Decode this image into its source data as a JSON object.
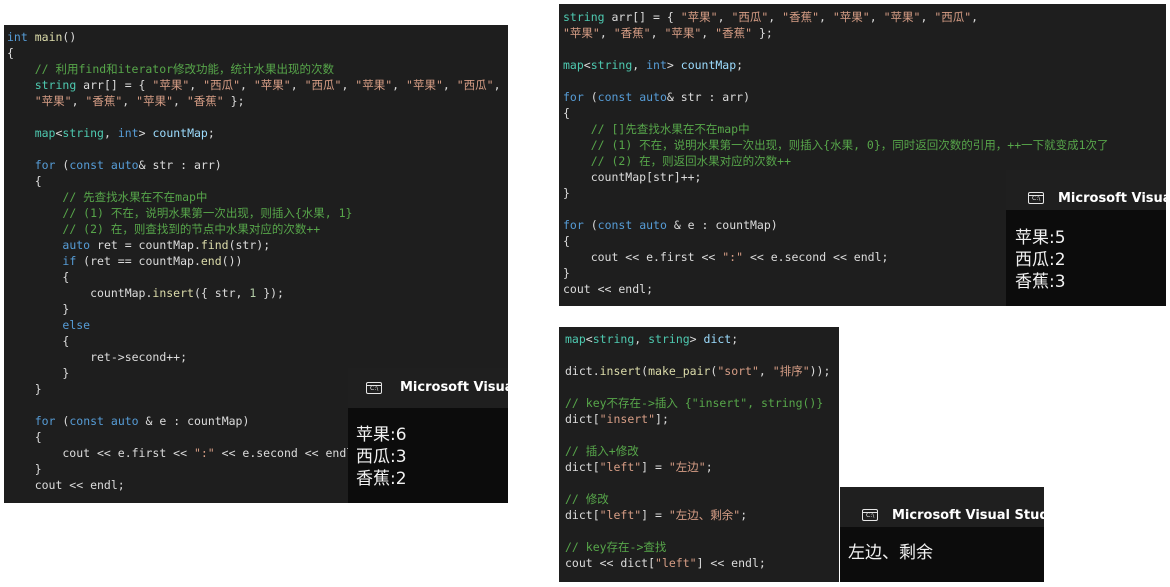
{
  "panel_left": {
    "lines": [
      [
        {
          "t": "int",
          "c": "kw"
        },
        {
          "t": " "
        },
        {
          "t": "main",
          "c": "fn"
        },
        {
          "t": "()"
        }
      ],
      [
        {
          "t": "{"
        }
      ],
      [
        {
          "t": "    "
        },
        {
          "t": "// 利用find和iterator修改功能，统计水果出现的次数",
          "c": "cm"
        }
      ],
      [
        {
          "t": "    "
        },
        {
          "t": "string",
          "c": "ty"
        },
        {
          "t": " arr[] = { "
        },
        {
          "t": "\"苹果\"",
          "c": "str"
        },
        {
          "t": ", "
        },
        {
          "t": "\"西瓜\"",
          "c": "str"
        },
        {
          "t": ", "
        },
        {
          "t": "\"苹果\"",
          "c": "str"
        },
        {
          "t": ", "
        },
        {
          "t": "\"西瓜\"",
          "c": "str"
        },
        {
          "t": ", "
        },
        {
          "t": "\"苹果\"",
          "c": "str"
        },
        {
          "t": ", "
        },
        {
          "t": "\"苹果\"",
          "c": "str"
        },
        {
          "t": ", "
        },
        {
          "t": "\"西瓜\"",
          "c": "str"
        },
        {
          "t": ","
        }
      ],
      [
        {
          "t": "    "
        },
        {
          "t": "\"苹果\"",
          "c": "str"
        },
        {
          "t": ", "
        },
        {
          "t": "\"香蕉\"",
          "c": "str"
        },
        {
          "t": ", "
        },
        {
          "t": "\"苹果\"",
          "c": "str"
        },
        {
          "t": ", "
        },
        {
          "t": "\"香蕉\"",
          "c": "str"
        },
        {
          "t": " };"
        }
      ],
      [],
      [
        {
          "t": "    "
        },
        {
          "t": "map",
          "c": "ty"
        },
        {
          "t": "<"
        },
        {
          "t": "string",
          "c": "ty"
        },
        {
          "t": ", "
        },
        {
          "t": "int",
          "c": "kw"
        },
        {
          "t": "> "
        },
        {
          "t": "countMap",
          "c": "var"
        },
        {
          "t": ";"
        }
      ],
      [],
      [
        {
          "t": "    "
        },
        {
          "t": "for",
          "c": "kw"
        },
        {
          "t": " ("
        },
        {
          "t": "const",
          "c": "kw"
        },
        {
          "t": " "
        },
        {
          "t": "auto",
          "c": "kw"
        },
        {
          "t": "& str : arr)"
        }
      ],
      [
        {
          "t": "    {"
        }
      ],
      [
        {
          "t": "        "
        },
        {
          "t": "// 先查找水果在不在map中",
          "c": "cm"
        }
      ],
      [
        {
          "t": "        "
        },
        {
          "t": "// (1) 不在，说明水果第一次出现，则插入{水果, 1}",
          "c": "cm"
        }
      ],
      [
        {
          "t": "        "
        },
        {
          "t": "// (2) 在，则查找到的节点中水果对应的次数++",
          "c": "cm"
        }
      ],
      [
        {
          "t": "        "
        },
        {
          "t": "auto",
          "c": "kw"
        },
        {
          "t": " ret = countMap."
        },
        {
          "t": "find",
          "c": "fn"
        },
        {
          "t": "(str);"
        }
      ],
      [
        {
          "t": "        "
        },
        {
          "t": "if",
          "c": "kw"
        },
        {
          "t": " (ret == countMap."
        },
        {
          "t": "end",
          "c": "fn"
        },
        {
          "t": "())"
        }
      ],
      [
        {
          "t": "        {"
        }
      ],
      [
        {
          "t": "            countMap."
        },
        {
          "t": "insert",
          "c": "fn"
        },
        {
          "t": "({ str, "
        },
        {
          "t": "1",
          "c": "num"
        },
        {
          "t": " });"
        }
      ],
      [
        {
          "t": "        }"
        }
      ],
      [
        {
          "t": "        "
        },
        {
          "t": "else",
          "c": "kw"
        }
      ],
      [
        {
          "t": "        {"
        }
      ],
      [
        {
          "t": "            ret->second++;"
        }
      ],
      [
        {
          "t": "        }"
        }
      ],
      [
        {
          "t": "    }"
        }
      ],
      [],
      [
        {
          "t": "    "
        },
        {
          "t": "for",
          "c": "kw"
        },
        {
          "t": " ("
        },
        {
          "t": "const",
          "c": "kw"
        },
        {
          "t": " "
        },
        {
          "t": "auto",
          "c": "kw"
        },
        {
          "t": " & e : countMap)"
        }
      ],
      [
        {
          "t": "    {"
        }
      ],
      [
        {
          "t": "        cout << e.first << "
        },
        {
          "t": "\":\"",
          "c": "str"
        },
        {
          "t": " << e.second << endl;"
        }
      ],
      [
        {
          "t": "    }"
        }
      ],
      [
        {
          "t": "    cout << endl;"
        }
      ]
    ],
    "console": {
      "title": "Microsoft Visual",
      "icon": "console-window-icon",
      "output": [
        "苹果:6",
        "西瓜:3",
        "香蕉:2"
      ]
    }
  },
  "panel_right_top": {
    "lines": [
      [
        {
          "t": "string",
          "c": "ty"
        },
        {
          "t": " arr[] = { "
        },
        {
          "t": "\"苹果\"",
          "c": "str"
        },
        {
          "t": ", "
        },
        {
          "t": "\"西瓜\"",
          "c": "str"
        },
        {
          "t": ", "
        },
        {
          "t": "\"香蕉\"",
          "c": "str"
        },
        {
          "t": ", "
        },
        {
          "t": "\"苹果\"",
          "c": "str"
        },
        {
          "t": ", "
        },
        {
          "t": "\"苹果\"",
          "c": "str"
        },
        {
          "t": ", "
        },
        {
          "t": "\"西瓜\"",
          "c": "str"
        },
        {
          "t": ","
        }
      ],
      [
        {
          "t": "\"苹果\"",
          "c": "str"
        },
        {
          "t": ", "
        },
        {
          "t": "\"香蕉\"",
          "c": "str"
        },
        {
          "t": ", "
        },
        {
          "t": "\"苹果\"",
          "c": "str"
        },
        {
          "t": ", "
        },
        {
          "t": "\"香蕉\"",
          "c": "str"
        },
        {
          "t": " };"
        }
      ],
      [],
      [
        {
          "t": "map",
          "c": "ty"
        },
        {
          "t": "<"
        },
        {
          "t": "string",
          "c": "ty"
        },
        {
          "t": ", "
        },
        {
          "t": "int",
          "c": "kw"
        },
        {
          "t": "> "
        },
        {
          "t": "countMap",
          "c": "var"
        },
        {
          "t": ";"
        }
      ],
      [],
      [
        {
          "t": "for",
          "c": "kw"
        },
        {
          "t": " ("
        },
        {
          "t": "const",
          "c": "kw"
        },
        {
          "t": " "
        },
        {
          "t": "auto",
          "c": "kw"
        },
        {
          "t": "& str : arr)"
        }
      ],
      [
        {
          "t": "{"
        }
      ],
      [
        {
          "t": "    "
        },
        {
          "t": "// []先查找水果在不在map中",
          "c": "cm"
        }
      ],
      [
        {
          "t": "    "
        },
        {
          "t": "// (1) 不在，说明水果第一次出现，则插入{水果, 0}，同时返回次数的引用，++一下就变成1次了",
          "c": "cm"
        }
      ],
      [
        {
          "t": "    "
        },
        {
          "t": "// (2) 在，则返回水果对应的次数++",
          "c": "cm"
        }
      ],
      [
        {
          "t": "    countMap[str]++;"
        }
      ],
      [
        {
          "t": "}"
        }
      ],
      [],
      [
        {
          "t": "for",
          "c": "kw"
        },
        {
          "t": " ("
        },
        {
          "t": "const",
          "c": "kw"
        },
        {
          "t": " "
        },
        {
          "t": "auto",
          "c": "kw"
        },
        {
          "t": " & e : countMap)"
        }
      ],
      [
        {
          "t": "{"
        }
      ],
      [
        {
          "t": "    cout << e.first << "
        },
        {
          "t": "\":\"",
          "c": "str"
        },
        {
          "t": " << e.second << endl;"
        }
      ],
      [
        {
          "t": "}"
        }
      ],
      [
        {
          "t": "cout << endl;"
        }
      ]
    ],
    "console": {
      "title": "Microsoft Visual",
      "icon": "console-window-icon",
      "output": [
        "苹果:5",
        "西瓜:2",
        "香蕉:3"
      ]
    }
  },
  "panel_right_bottom": {
    "lines": [
      [
        {
          "t": "map",
          "c": "ty"
        },
        {
          "t": "<"
        },
        {
          "t": "string",
          "c": "ty"
        },
        {
          "t": ", "
        },
        {
          "t": "string",
          "c": "ty"
        },
        {
          "t": "> "
        },
        {
          "t": "dict",
          "c": "var"
        },
        {
          "t": ";"
        }
      ],
      [],
      [
        {
          "t": "dict."
        },
        {
          "t": "insert",
          "c": "fn"
        },
        {
          "t": "("
        },
        {
          "t": "make_pair",
          "c": "fn"
        },
        {
          "t": "("
        },
        {
          "t": "\"sort\"",
          "c": "str"
        },
        {
          "t": ", "
        },
        {
          "t": "\"排序\"",
          "c": "str"
        },
        {
          "t": "));"
        }
      ],
      [],
      [
        {
          "t": "// key不存在->插入 {\"insert\", string()}",
          "c": "cm"
        }
      ],
      [
        {
          "t": "dict["
        },
        {
          "t": "\"insert\"",
          "c": "str"
        },
        {
          "t": "];"
        }
      ],
      [],
      [
        {
          "t": "// 插入+修改",
          "c": "cm"
        }
      ],
      [
        {
          "t": "dict["
        },
        {
          "t": "\"left\"",
          "c": "str"
        },
        {
          "t": "] = "
        },
        {
          "t": "\"左边\"",
          "c": "str"
        },
        {
          "t": ";"
        }
      ],
      [],
      [
        {
          "t": "// 修改",
          "c": "cm"
        }
      ],
      [
        {
          "t": "dict["
        },
        {
          "t": "\"left\"",
          "c": "str"
        },
        {
          "t": "] = "
        },
        {
          "t": "\"左边、剩余\"",
          "c": "str"
        },
        {
          "t": ";"
        }
      ],
      [],
      [
        {
          "t": "// key存在->查找",
          "c": "cm"
        }
      ],
      [
        {
          "t": "cout << dict["
        },
        {
          "t": "\"left\"",
          "c": "str"
        },
        {
          "t": "] << endl;"
        }
      ]
    ],
    "console": {
      "title": "Microsoft Visual Studio",
      "icon": "console-window-icon",
      "output": [
        "左边、剩余"
      ]
    }
  }
}
